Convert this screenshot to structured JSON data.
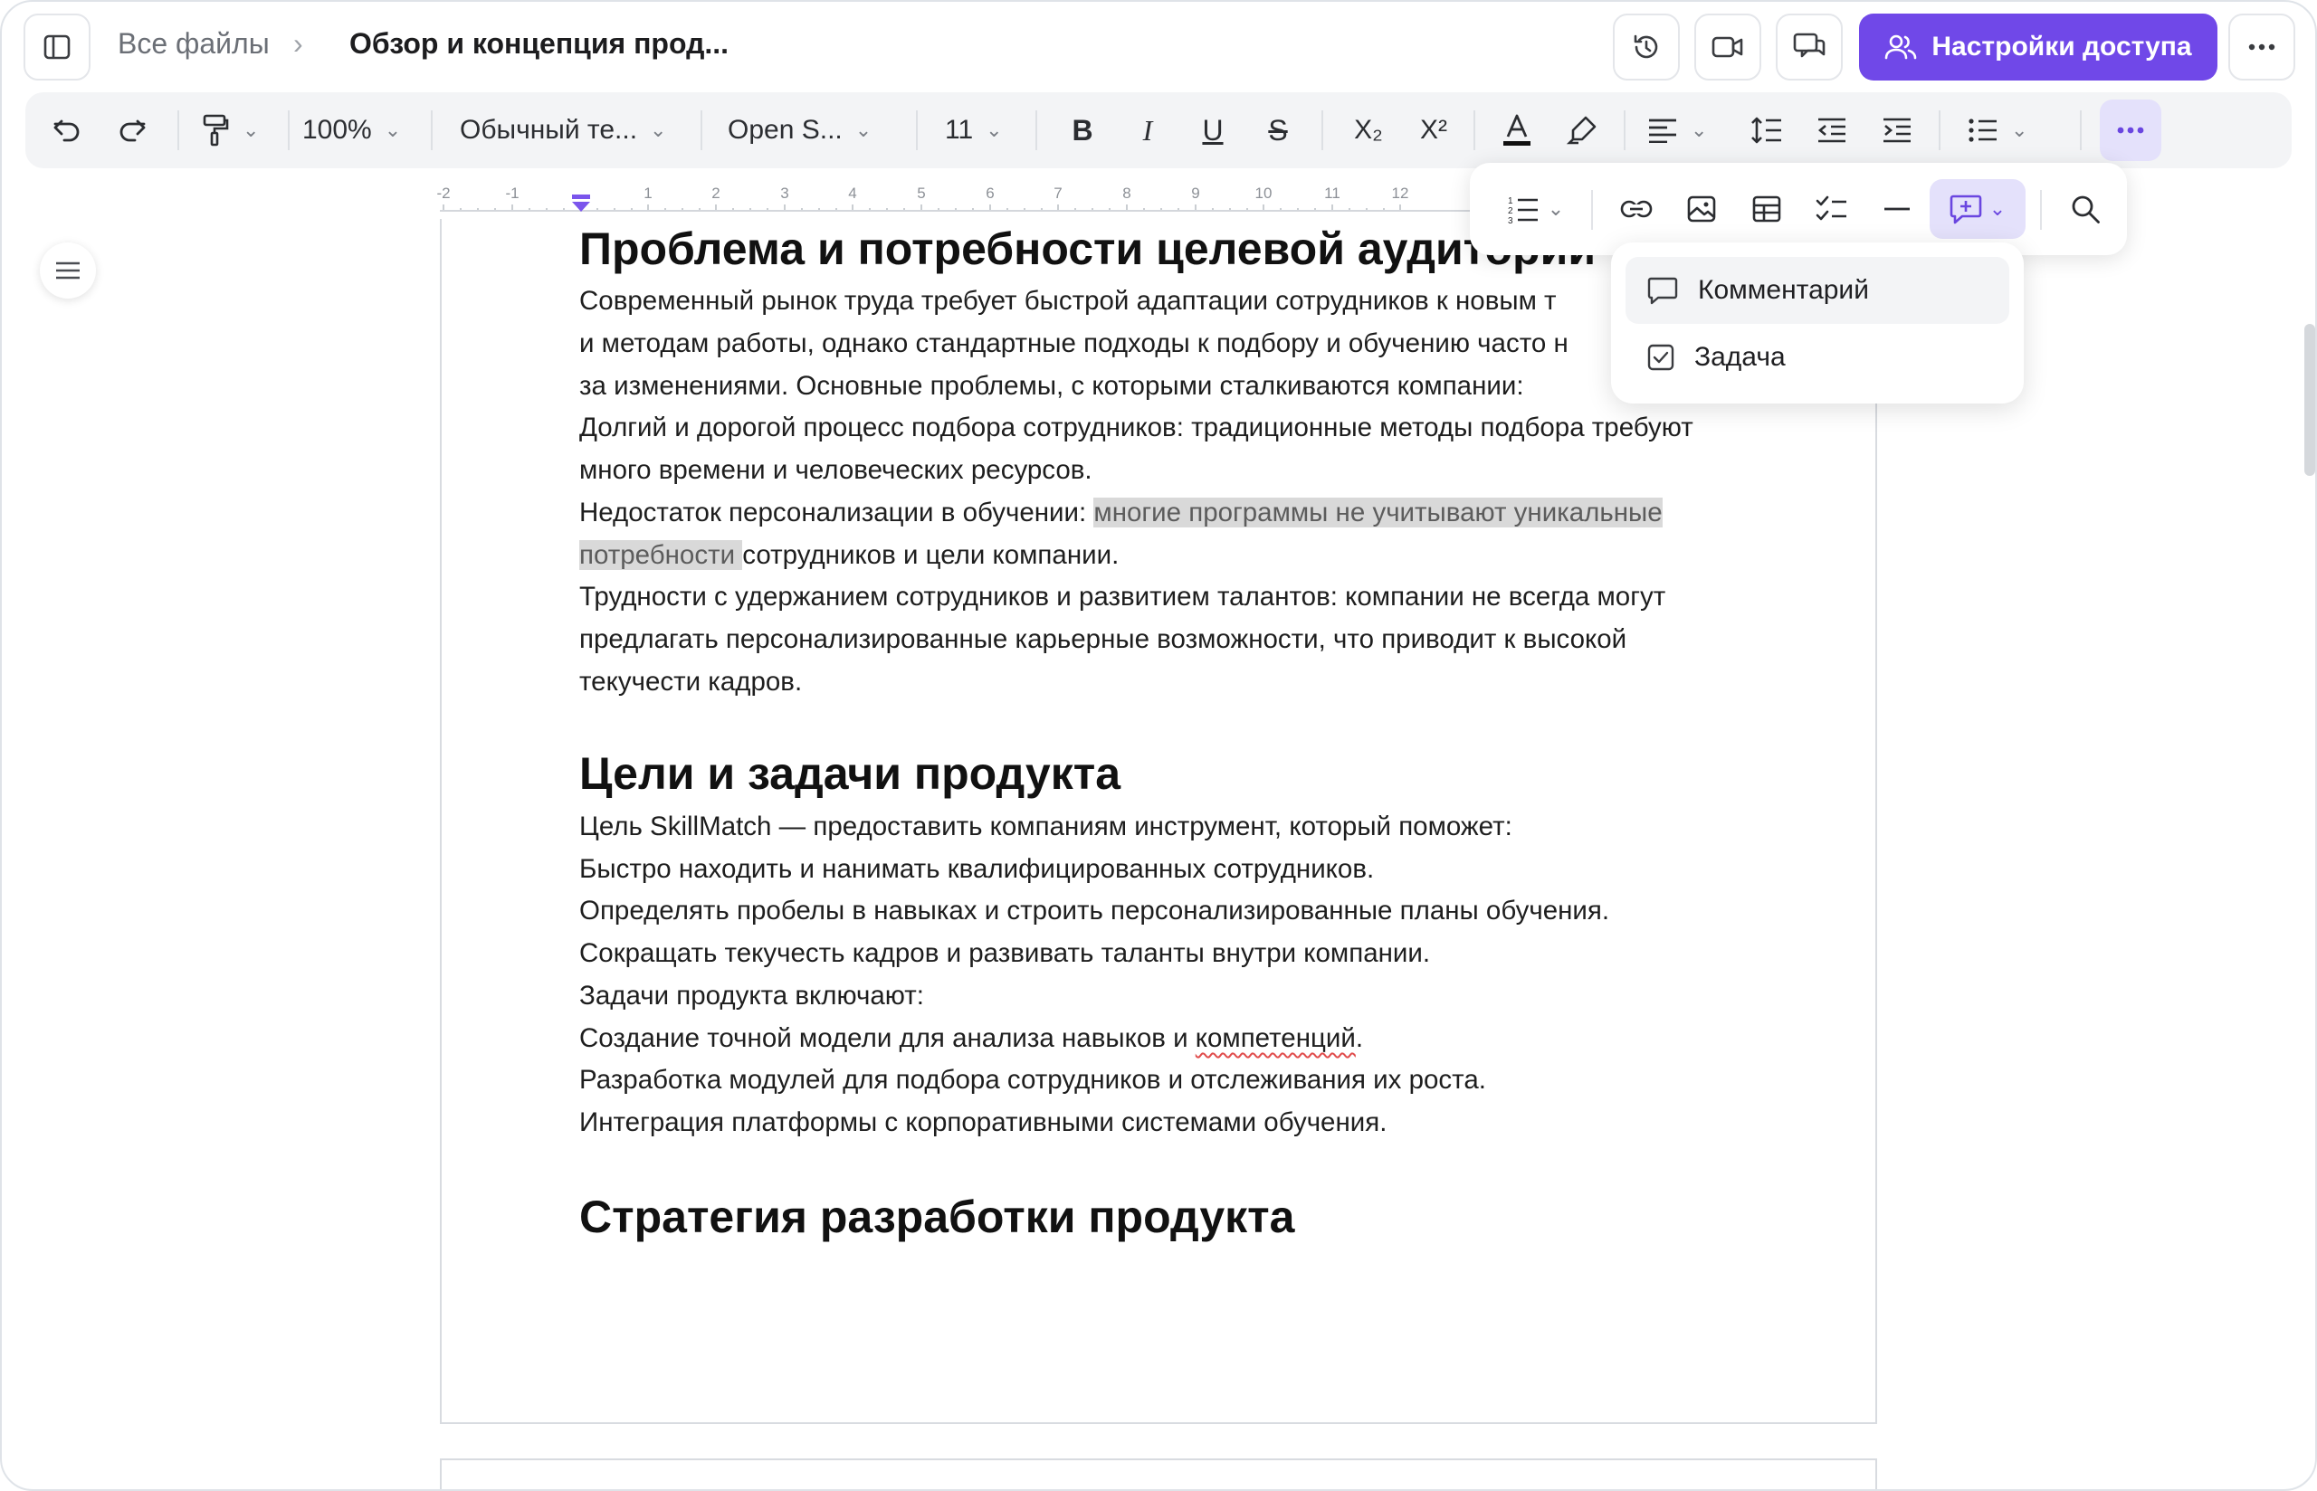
{
  "header": {
    "breadcrumb_root": "Все файлы",
    "breadcrumb_sep": "›",
    "doc_title": "Обзор и концепция прод...",
    "access_button": "Настройки доступа"
  },
  "toolbar": {
    "zoom": "100%",
    "style": "Обычный те...",
    "font": "Open S...",
    "size": "11",
    "subscript_label": "X₂",
    "superscript_label": "X²"
  },
  "ruler": {
    "labels": [
      "-2",
      "-1",
      "1",
      "2",
      "3",
      "4",
      "5",
      "6",
      "7",
      "8",
      "9",
      "10",
      "11",
      "12"
    ]
  },
  "insert_menu": {
    "items": [
      {
        "label": "Комментарий",
        "icon": "comment-icon"
      },
      {
        "label": "Задача",
        "icon": "task-checkbox-icon"
      }
    ]
  },
  "document": {
    "h1": "Проблема и потребности целевой аудитории",
    "p1": "Современный рынок труда требует быстрой адаптации сотрудников к новым т",
    "p2": "и методам работы, однако стандартные подходы к подбору и обучению часто н",
    "p3": "за изменениями. Основные проблемы, с которыми сталкиваются компании:",
    "p4": "Долгий и дорогой процесс подбора сотрудников: традиционные методы подбора требуют",
    "p5": "много времени и человеческих ресурсов.",
    "p6a": "Недостаток персонализации в обучении: ",
    "p6b": "многие программы не учитывают уникальные",
    "p7a": "потребности ",
    "p7b": "сотрудников и цели компании.",
    "p8": "Трудности с удержанием сотрудников и развитием талантов: компании не всегда могут",
    "p9": "предлагать персонализированные карьерные возможности, что приводит к высокой",
    "p10": "текучести кадров.",
    "h2": "Цели и задачи продукта",
    "q1": "Цель SkillMatch — предоставить компаниям инструмент, который поможет:",
    "q2": "Быстро находить и нанимать квалифицированных сотрудников.",
    "q3": "Определять пробелы в навыках и строить персонализированные планы обучения.",
    "q4": "Сокращать текучесть кадров и развивать таланты внутри компании.",
    "q5": "Задачи продукта включают:",
    "q6a": "Создание точной модели для анализа навыков и ",
    "q6b": "компетенций",
    "q6c": ".",
    "q7": "Разработка модулей для подбора сотрудников и отслеживания их роста.",
    "q8": "Интеграция платформы с корпоративными системами обучения.",
    "h3": "Стратегия разработки продукта"
  }
}
